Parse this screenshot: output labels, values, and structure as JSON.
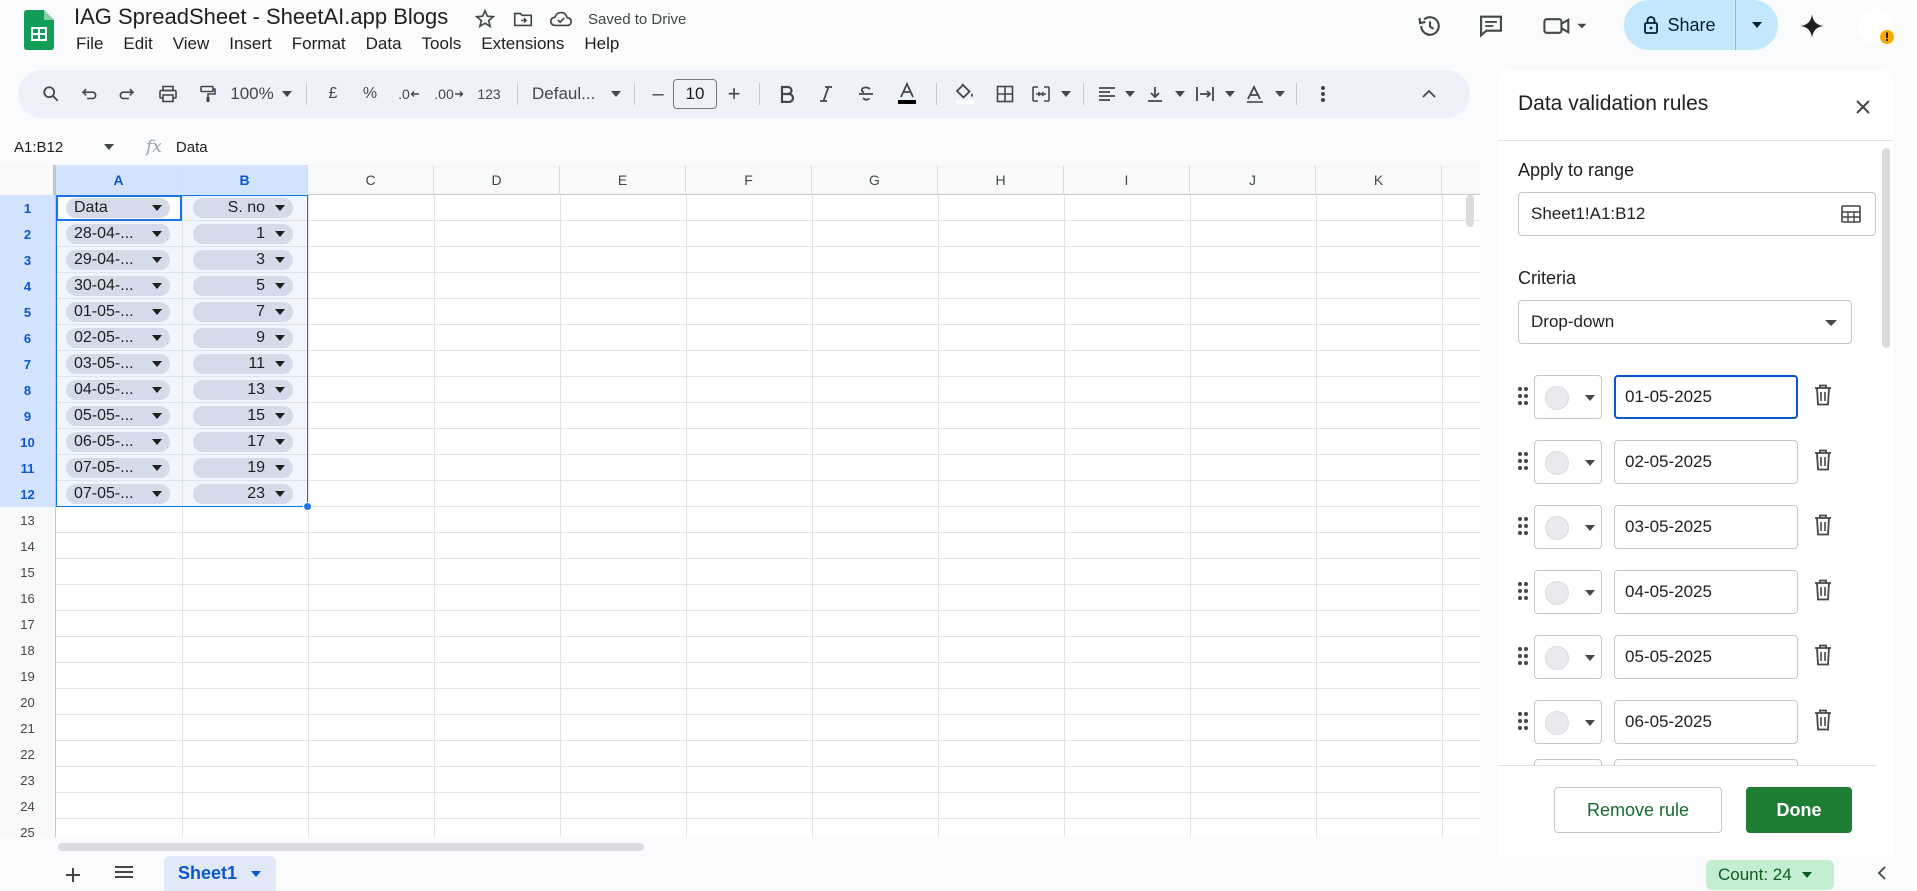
{
  "app": {
    "doc_title": "IAG SpreadSheet - SheetAI.app Blogs",
    "saved_status": "Saved to Drive",
    "share_label": "Share",
    "menu": [
      "File",
      "Edit",
      "View",
      "Insert",
      "Format",
      "Data",
      "Tools",
      "Extensions",
      "Help"
    ]
  },
  "toolbar": {
    "zoom": "100%",
    "currency": "£",
    "percent": "%",
    "dec_decrease": ".0",
    "dec_increase": ".00",
    "number_format": "123",
    "font": "Defaul...",
    "font_size": "10",
    "minus": "–",
    "plus": "+"
  },
  "formula_bar": {
    "name_box": "A1:B12",
    "fx": "fx",
    "value": "Data"
  },
  "grid": {
    "columns": [
      "A",
      "B",
      "C",
      "D",
      "E",
      "F",
      "G",
      "H",
      "I",
      "J",
      "K"
    ],
    "rows": [
      "1",
      "2",
      "3",
      "4",
      "5",
      "6",
      "7",
      "8",
      "9",
      "10",
      "11",
      "12",
      "13",
      "14",
      "15",
      "16",
      "17",
      "18",
      "19",
      "20",
      "21",
      "22",
      "23",
      "24",
      "25"
    ],
    "header_a": "Data",
    "header_b": "S. no",
    "data_a": [
      "28-04-...",
      "29-04-...",
      "30-04-...",
      "01-05-...",
      "02-05-...",
      "03-05-...",
      "04-05-...",
      "05-05-...",
      "06-05-...",
      "07-05-...",
      "07-05-..."
    ],
    "data_b": [
      "1",
      "3",
      "5",
      "7",
      "9",
      "11",
      "13",
      "15",
      "17",
      "19",
      "23"
    ]
  },
  "sheets": {
    "active": "Sheet1",
    "count": "Count: 24"
  },
  "panel": {
    "title": "Data validation rules",
    "apply_label": "Apply to range",
    "range": "Sheet1!A1:B12",
    "criteria_label": "Criteria",
    "criteria_value": "Drop-down",
    "options": [
      "01-05-2025",
      "02-05-2025",
      "03-05-2025",
      "04-05-2025",
      "05-05-2025",
      "06-05-2025"
    ],
    "remove_label": "Remove rule",
    "done_label": "Done"
  }
}
